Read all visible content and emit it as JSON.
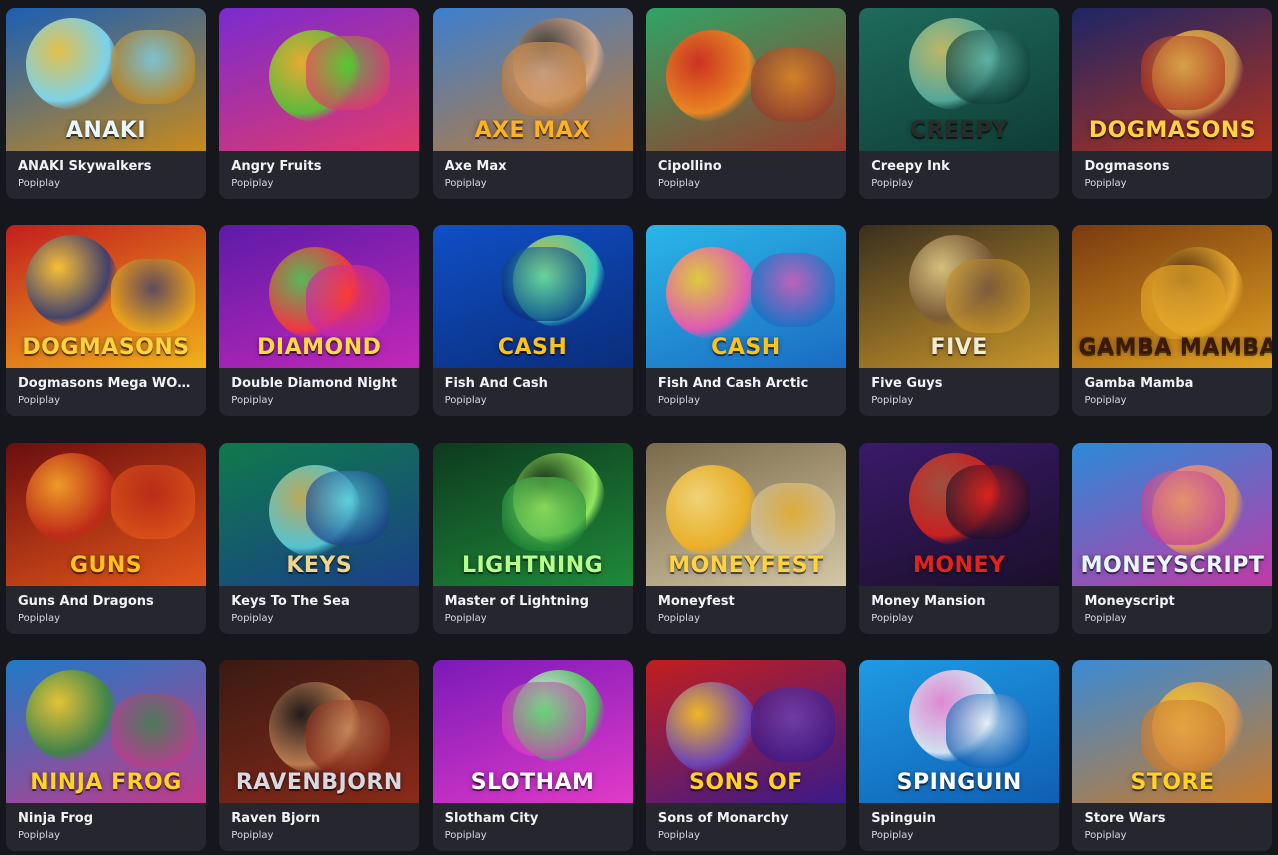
{
  "games": [
    {
      "name": "ANAKI Skywalkers",
      "provider": "Popiplay",
      "art_text": "ANAKI",
      "bg1": "#1a5fb4",
      "bg2": "#c98a1b",
      "c1": "#7fe3ff",
      "c2": "#ffcf40",
      "ink": "#e8f6ff"
    },
    {
      "name": "Angry Fruits",
      "provider": "Popiplay",
      "art_text": "",
      "bg1": "#7a2ad1",
      "bg2": "#e23a6a",
      "c1": "#4fd12c",
      "c2": "#f2c01e",
      "ink": "#ffd84a"
    },
    {
      "name": "Axe Max",
      "provider": "Popiplay",
      "art_text": "AXE MAX",
      "bg1": "#3b7fd0",
      "bg2": "#c07a34",
      "c1": "#e7b38a",
      "c2": "#2a2a2a",
      "ink": "#ffb21e"
    },
    {
      "name": "Cipollino",
      "provider": "Popiplay",
      "art_text": "",
      "bg1": "#2fa566",
      "bg2": "#9a3b2a",
      "c1": "#ff8a1c",
      "c2": "#e2231a",
      "ink": "#f5e0c2"
    },
    {
      "name": "Creepy Ink",
      "provider": "Popiplay",
      "art_text": "CREEPY",
      "bg1": "#1e6b5c",
      "bg2": "#0f3d36",
      "c1": "#5fb6a8",
      "c2": "#d8c76a",
      "ink": "#2b2b2b"
    },
    {
      "name": "Dogmasons",
      "provider": "Popiplay",
      "art_text": "DOGMASONS",
      "bg1": "#1d2566",
      "bg2": "#b3331e",
      "c1": "#d09a4f",
      "c2": "#ffcc33",
      "ink": "#ffd23f"
    },
    {
      "name": "Dogmasons Mega WOOF",
      "provider": "Popiplay",
      "art_text": "DOGMASONS",
      "bg1": "#c21e1e",
      "bg2": "#f2b21a",
      "c1": "#2a3c7a",
      "c2": "#ffd43a",
      "ink": "#ffd23f"
    },
    {
      "name": "Double Diamond Night",
      "provider": "Popiplay",
      "art_text": "DIAMOND",
      "bg1": "#5d1aa8",
      "bg2": "#c328b8",
      "c1": "#ff3b30",
      "c2": "#53d14a",
      "ink": "#ffd84a"
    },
    {
      "name": "Fish And Cash",
      "provider": "Popiplay",
      "art_text": "CASH",
      "bg1": "#0f4fc6",
      "bg2": "#0a2d7a",
      "c1": "#41e0c0",
      "c2": "#ffce1f",
      "ink": "#ffc21a"
    },
    {
      "name": "Fish And Cash Arctic",
      "provider": "Popiplay",
      "art_text": "CASH",
      "bg1": "#2ab6e8",
      "bg2": "#1b6bc2",
      "c1": "#ff4fb0",
      "c2": "#ffd21f",
      "ink": "#ffc21a"
    },
    {
      "name": "Five Guys",
      "provider": "Popiplay",
      "art_text": "FIVE",
      "bg1": "#3a2f1e",
      "bg2": "#c9962a",
      "c1": "#7b5a3a",
      "c2": "#e7d28a",
      "ink": "#f3ead0"
    },
    {
      "name": "Gamba Mamba",
      "provider": "Popiplay",
      "art_text": "GAMBA MAMBA",
      "bg1": "#7a3a0f",
      "bg2": "#e0a121",
      "c1": "#f0b233",
      "c2": "#3b1a08",
      "ink": "#3a1a06"
    },
    {
      "name": "Guns And Dragons",
      "provider": "Popiplay",
      "art_text": "GUNS",
      "bg1": "#6b0e0e",
      "bg2": "#e3561a",
      "c1": "#c32a1a",
      "c2": "#ffb02a",
      "ink": "#ffc21a"
    },
    {
      "name": "Keys To The Sea",
      "provider": "Popiplay",
      "art_text": "KEYS",
      "bg1": "#0e7a4a",
      "bg2": "#1b3f8a",
      "c1": "#5fd6e3",
      "c2": "#d8b45a",
      "ink": "#f0d48a"
    },
    {
      "name": "Master of Lightning",
      "provider": "Popiplay",
      "art_text": "LIGHTNING",
      "bg1": "#0d3a1e",
      "bg2": "#1f8a3a",
      "c1": "#a7ff6a",
      "c2": "#0a1f10",
      "ink": "#b7ff8a"
    },
    {
      "name": "Moneyfest",
      "provider": "Popiplay",
      "art_text": "MONEYFEST",
      "bg1": "#7a6a4a",
      "bg2": "#d3c7a6",
      "c1": "#f4b21a",
      "c2": "#ffe07a",
      "ink": "#ffd23f"
    },
    {
      "name": "Money Mansion",
      "provider": "Popiplay",
      "art_text": "MONEY",
      "bg1": "#3a1a6a",
      "bg2": "#1a0f2a",
      "c1": "#e2231a",
      "c2": "#b35a3a",
      "ink": "#e2231a"
    },
    {
      "name": "Moneyscript",
      "provider": "Popiplay",
      "art_text": "moneyscript",
      "bg1": "#2a8ad6",
      "bg2": "#c23aa8",
      "c1": "#e3a14a",
      "c2": "#ff6fb8",
      "ink": "#e8f6ff"
    },
    {
      "name": "Ninja Frog",
      "provider": "Popiplay",
      "art_text": "NINJA FROG",
      "bg1": "#1f7ac6",
      "bg2": "#c23a8a",
      "c1": "#3a8a3a",
      "c2": "#ffd21f",
      "ink": "#ffd21f"
    },
    {
      "name": "Raven Bjorn",
      "provider": "Popiplay",
      "art_text": "RavenBjorn",
      "bg1": "#3a1a12",
      "bg2": "#8a2a1a",
      "c1": "#c98a5a",
      "c2": "#1a1a1a",
      "ink": "#d8d8e0"
    },
    {
      "name": "Slotham City",
      "provider": "Popiplay",
      "art_text": "SLOTHAM",
      "bg1": "#7a1ab8",
      "bg2": "#e23ac8",
      "c1": "#3ad14a",
      "c2": "#ffffff",
      "ink": "#ffffff"
    },
    {
      "name": "Sons of Monarchy",
      "provider": "Popiplay",
      "art_text": "SONS OF",
      "bg1": "#c21e1e",
      "bg2": "#3a1a8a",
      "c1": "#6a4ac6",
      "c2": "#ffd21f",
      "ink": "#ffd21f"
    },
    {
      "name": "Spinguin",
      "provider": "Popiplay",
      "art_text": "SPINGUIN",
      "bg1": "#1f9ae3",
      "bg2": "#0f5fb4",
      "c1": "#f2f4f8",
      "c2": "#ff8ad0",
      "ink": "#ffffff"
    },
    {
      "name": "Store Wars",
      "provider": "Popiplay",
      "art_text": "STORE",
      "bg1": "#3a8ad6",
      "bg2": "#c97a2a",
      "c1": "#e39a4a",
      "c2": "#ffd21f",
      "ink": "#ffd21f"
    }
  ]
}
